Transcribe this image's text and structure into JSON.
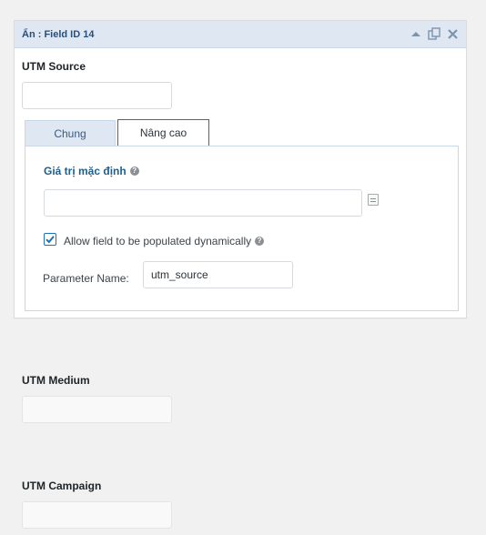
{
  "panel": {
    "title": "Ẩn : Field ID 14",
    "icons": [
      "collapse-arrow-icon",
      "duplicate-icon",
      "close-icon"
    ]
  },
  "utm_source": {
    "label": "UTM Source",
    "value": ""
  },
  "tabs": [
    {
      "label": "Chung",
      "active": false
    },
    {
      "label": "Nâng cao",
      "active": true
    }
  ],
  "advanced": {
    "default_value_label": "Giá trị mặc định",
    "default_value": "",
    "dynamic_label": "Allow field to be populated dynamically",
    "dynamic_checked": true,
    "parameter_label": "Parameter Name:",
    "parameter_value": "utm_source"
  },
  "utm_medium": {
    "label": "UTM Medium",
    "value": ""
  },
  "utm_campaign": {
    "label": "UTM Campaign",
    "value": ""
  },
  "colors": {
    "accent": "#2271b1",
    "header_bg": "#dfe8f2",
    "section_label": "#1e5f8c",
    "background": "#f1f1f1"
  }
}
